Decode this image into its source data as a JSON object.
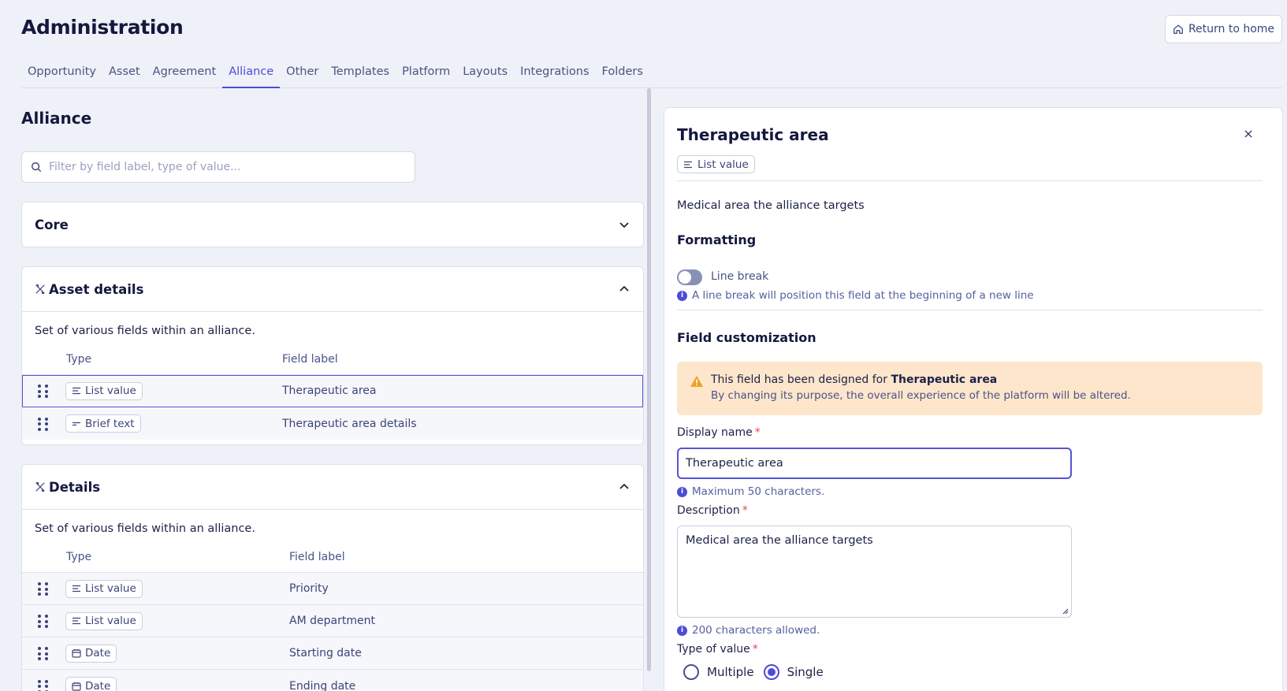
{
  "header": {
    "title": "Administration",
    "home_button": "Return to home"
  },
  "tabs": [
    "Opportunity",
    "Asset",
    "Agreement",
    "Alliance",
    "Other",
    "Templates",
    "Platform",
    "Layouts",
    "Integrations",
    "Folders"
  ],
  "active_tab": "Alliance",
  "left": {
    "title": "Alliance",
    "search_placeholder": "Filter by field label, type of value...",
    "core": {
      "title": "Core"
    },
    "asset_details": {
      "title": "Asset details",
      "description": "Set of various fields within an alliance.",
      "col_type": "Type",
      "col_label": "Field label",
      "rows": [
        {
          "type": "List value",
          "label": "Therapeutic area"
        },
        {
          "type": "Brief text",
          "label": "Therapeutic area details"
        }
      ]
    },
    "details": {
      "title": "Details",
      "description": "Set of various fields within an alliance.",
      "col_type": "Type",
      "col_label": "Field label",
      "rows": [
        {
          "type": "List value",
          "label": "Priority"
        },
        {
          "type": "List value",
          "label": "AM department"
        },
        {
          "type": "Date",
          "label": "Starting date"
        },
        {
          "type": "Date",
          "label": "Ending date"
        }
      ]
    }
  },
  "panel": {
    "title": "Therapeutic area",
    "type_chip": "List value",
    "description": "Medical area the alliance targets",
    "formatting_title": "Formatting",
    "line_break_label": "Line break",
    "line_break_hint": "A line break will position this field at the beginning of a new line",
    "customization_title": "Field customization",
    "warning_prefix": "This field has been designed for ",
    "warning_bold": "Therapeutic area",
    "warning_sub": "By changing its purpose, the overall experience of the platform will be altered.",
    "display_name_label": "Display name",
    "display_name_value": "Therapeutic area",
    "display_name_hint": "Maximum 50 characters.",
    "description_label": "Description",
    "description_value": "Medical area the alliance targets",
    "description_hint": "200 characters allowed.",
    "type_of_value_label": "Type of value",
    "radio_multiple": "Multiple",
    "radio_single": "Single",
    "required_mark": "*"
  },
  "colors": {
    "accent": "#4d4bd9",
    "warning_bg": "#fde6cc",
    "warning_icon": "#f0a020"
  }
}
